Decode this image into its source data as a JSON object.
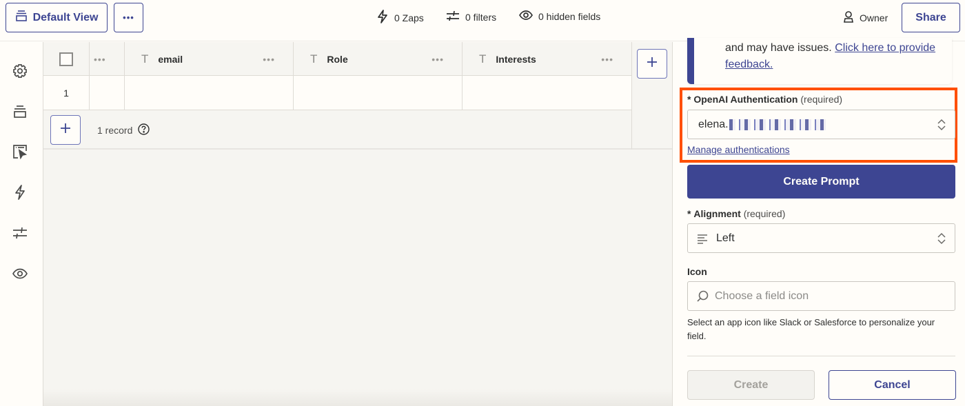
{
  "topbar": {
    "view_label": "Default View",
    "more_label": "•••",
    "stats": [
      {
        "icon": "lightning-icon",
        "label": "0 Zaps"
      },
      {
        "icon": "filter-icon",
        "label": "0 filters"
      },
      {
        "icon": "eye-icon",
        "label": "0 hidden fields"
      }
    ],
    "owner_label": "Owner",
    "share_label": "Share"
  },
  "sidebar": {
    "items": [
      {
        "icon": "gear-icon",
        "label": "Settings"
      },
      {
        "icon": "views-icon",
        "label": "Views"
      },
      {
        "icon": "interface-icon",
        "label": "Interfaces"
      },
      {
        "icon": "lightning-icon",
        "label": "Zaps"
      },
      {
        "icon": "filter-icon",
        "label": "Filters"
      },
      {
        "icon": "eye-icon",
        "label": "Hidden fields"
      }
    ]
  },
  "table": {
    "columns": [
      {
        "name": "email",
        "type": "text"
      },
      {
        "name": "Role",
        "type": "text"
      },
      {
        "name": "Interests",
        "type": "text"
      }
    ],
    "rows": [
      {
        "index": "1",
        "cells": [
          "",
          "",
          ""
        ]
      }
    ],
    "record_count": "1 record"
  },
  "panel": {
    "notice_text": "and may have issues.",
    "notice_link": "Click here to provide feedback.",
    "auth": {
      "label": "OpenAI Authentication",
      "required": "(required)",
      "value_prefix": "elena.",
      "value_redacted": true,
      "manage_link": "Manage authentications"
    },
    "create_prompt_label": "Create Prompt",
    "alignment": {
      "label": "Alignment",
      "required": "(required)",
      "value": "Left"
    },
    "icon_field": {
      "label": "Icon",
      "placeholder": "Choose a field icon",
      "help": "Select an app icon like Slack or Salesforce to personalize your field."
    },
    "create_label": "Create",
    "cancel_label": "Cancel"
  },
  "colors": {
    "brand": "#3d4592",
    "highlight": "#ff4f00",
    "background": "#fffdf9"
  }
}
